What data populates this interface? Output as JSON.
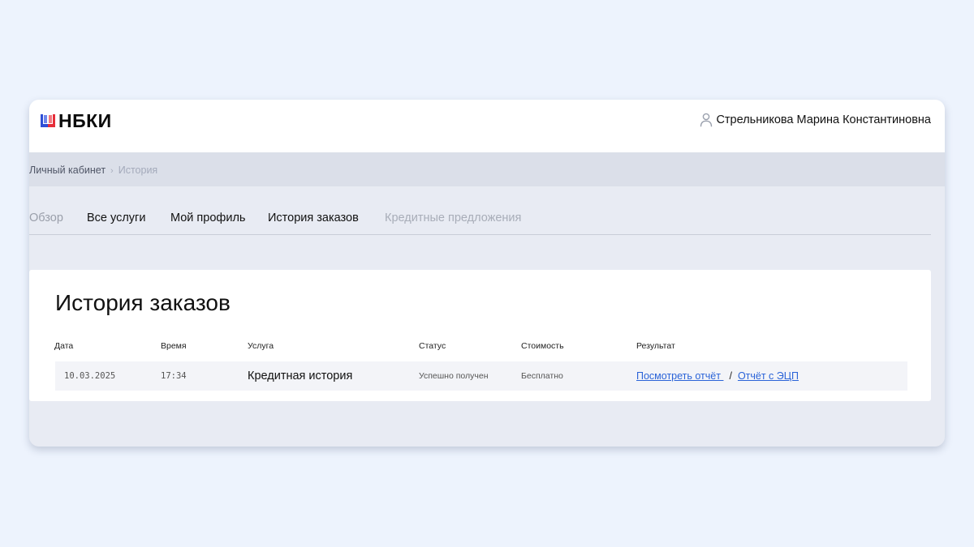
{
  "header": {
    "logo_text": "НБКИ",
    "logo_icon": "nbki-logo-icon",
    "user_icon": "user-icon",
    "user_name": "Стрельникова Марина Константиновна"
  },
  "breadcrumb": {
    "items": [
      "Личный кабинет",
      "История"
    ],
    "separator": "›"
  },
  "tabs": [
    {
      "label": "Обзор"
    },
    {
      "label": "Все услуги"
    },
    {
      "label": "Мой профиль"
    },
    {
      "label": "История заказов"
    },
    {
      "label": "Кредитные предложения"
    }
  ],
  "orders": {
    "title": "История заказов",
    "columns": [
      "Дата",
      "Время",
      "Услуга",
      "Статус",
      "Стоимость",
      "Результат"
    ],
    "rows": [
      {
        "date": "10.03.2025",
        "time": "17:34",
        "service": "Кредитная история",
        "status": "Успешно получен",
        "cost": "Бесплатно",
        "result_link_1": "Посмотреть отчёт ",
        "result_separator": "/",
        "result_link_2": "Отчёт с ЭЦП"
      }
    ]
  },
  "colors": {
    "page_bg": "#edf3fd",
    "link": "#2a63d8",
    "logo_red": "#e62e3a",
    "logo_blue": "#2f4fd6"
  }
}
